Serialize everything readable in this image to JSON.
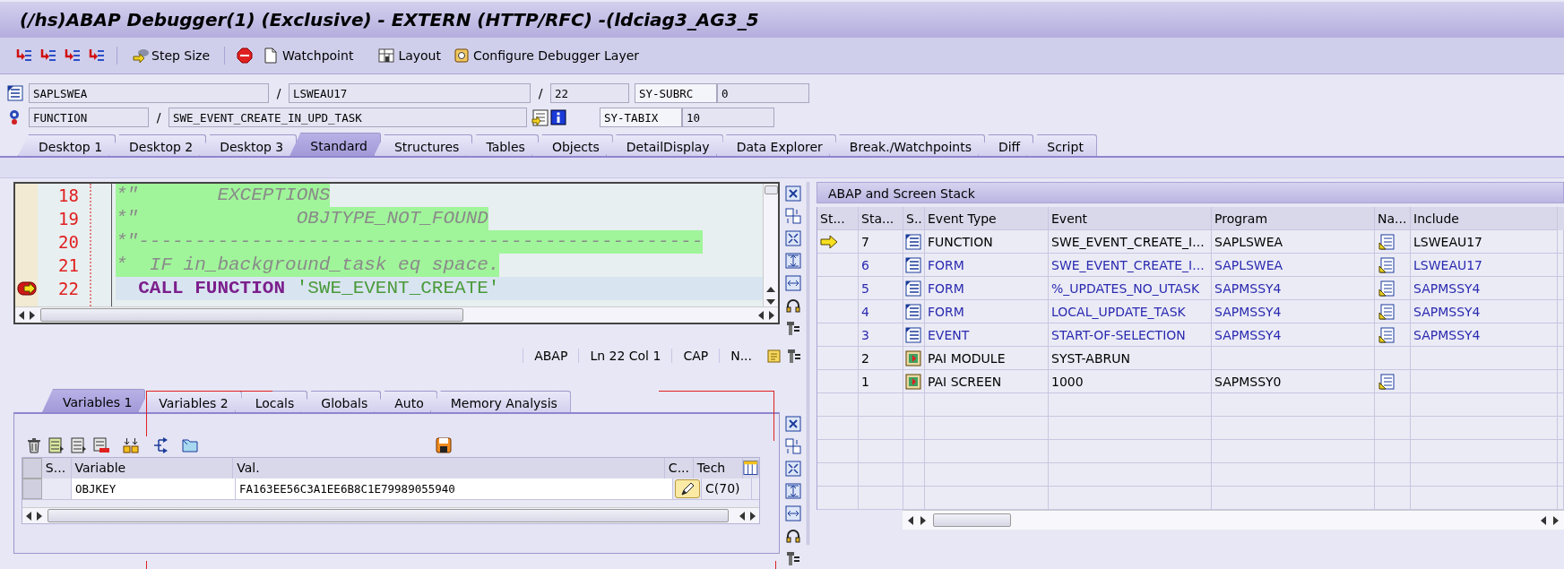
{
  "window": {
    "title": "(/hs)ABAP Debugger(1)  (Exclusive) - EXTERN (HTTP/RFC) -(ldciag3_AG3_5"
  },
  "toolbar": [
    {
      "label": "Step Size"
    },
    {
      "label": "Watchpoint"
    },
    {
      "label": "Layout"
    },
    {
      "label": "Configure Debugger Layer"
    }
  ],
  "info_rows": [
    [
      {
        "kind": "field",
        "value": "SAPLSWEA"
      },
      {
        "kind": "sep",
        "text": "/"
      },
      {
        "kind": "field",
        "value": "LSWEAU17"
      },
      {
        "kind": "sep",
        "text": "/"
      },
      {
        "kind": "field",
        "value": "22"
      },
      {
        "kind": "label",
        "text": "SY-SUBRC"
      },
      {
        "kind": "field",
        "value": "0"
      }
    ],
    [
      {
        "kind": "field",
        "value": "FUNCTION"
      },
      {
        "kind": "sep",
        "text": "/"
      },
      {
        "kind": "field",
        "value": "SWE_EVENT_CREATE_IN_UPD_TASK"
      },
      {
        "kind": "icons"
      },
      {
        "kind": "label",
        "text": "SY-TABIX"
      },
      {
        "kind": "field",
        "value": "10"
      }
    ]
  ],
  "desktop_tabs": [
    {
      "label": "Desktop 1",
      "selected": false
    },
    {
      "label": "Desktop 2",
      "selected": false
    },
    {
      "label": "Desktop 3",
      "selected": false
    },
    {
      "label": "Standard",
      "selected": true
    },
    {
      "label": "Structures",
      "selected": false
    },
    {
      "label": "Tables",
      "selected": false
    },
    {
      "label": "Objects",
      "selected": false
    },
    {
      "label": "DetailDisplay",
      "selected": false
    },
    {
      "label": "Data Explorer",
      "selected": false
    },
    {
      "label": "Break./Watchpoints",
      "selected": false
    },
    {
      "label": "Diff",
      "selected": false
    },
    {
      "label": "Script",
      "selected": false
    }
  ],
  "source_code": {
    "lines": [
      {
        "number": "18",
        "highlighted": true,
        "current": false,
        "marker": false,
        "tokens": [
          {
            "kind": "comment",
            "text": "*\"       EXCEPTIONS"
          }
        ]
      },
      {
        "number": "19",
        "highlighted": true,
        "current": false,
        "marker": false,
        "tokens": [
          {
            "kind": "comment",
            "text": "*\"              OBJTYPE_NOT_FOUND"
          }
        ]
      },
      {
        "number": "20",
        "highlighted": true,
        "current": false,
        "marker": false,
        "tokens": [
          {
            "kind": "comment",
            "text": "*\"--------------------------------------------------"
          }
        ]
      },
      {
        "number": "21",
        "highlighted": true,
        "current": false,
        "marker": false,
        "tokens": [
          {
            "kind": "comment",
            "text": "*  IF in_background_task eq space."
          }
        ]
      },
      {
        "number": "22",
        "highlighted": false,
        "current": true,
        "marker": true,
        "tokens": [
          {
            "kind": "keyword",
            "text": "  CALL FUNCTION"
          },
          {
            "kind": "string",
            "text": "'SWE_EVENT_CREATE'"
          }
        ]
      }
    ],
    "status": [
      "ABAP",
      "Ln  22 Col   1",
      "CAP",
      "N..."
    ]
  },
  "variable_tabs": [
    {
      "label": "Variables 1",
      "selected": true
    },
    {
      "label": "Variables 2",
      "selected": false
    },
    {
      "label": "Locals",
      "selected": false
    },
    {
      "label": "Globals",
      "selected": false
    },
    {
      "label": "Auto",
      "selected": false
    },
    {
      "label": "Memory Analysis",
      "selected": false
    }
  ],
  "variables": {
    "columns": [
      "S...",
      "Variable",
      "Val.",
      "C...",
      "Tech"
    ],
    "rows": [
      {
        "variable": "OBJKEY",
        "value": "FA163EE56C3A1EE6B8C1E79989055940",
        "type": "C(70)"
      }
    ]
  },
  "stack": {
    "title": "ABAP and Screen Stack",
    "columns": [
      "St...",
      "Sta...",
      "S..",
      "Event Type",
      "Event",
      "Program",
      "Na...",
      "Include"
    ],
    "rows": [
      {
        "current": true,
        "no": "7",
        "kind": "source",
        "event_type": "FUNCTION",
        "event": "SWE_EVENT_CREATE_I...",
        "program": "SAPLSWEA",
        "navigable": true,
        "include": "LSWEAU17",
        "color": "#000000"
      },
      {
        "current": false,
        "no": "6",
        "kind": "source",
        "event_type": "FORM",
        "event": "SWE_EVENT_CREATE_I...",
        "program": "SAPLSWEA",
        "navigable": true,
        "include": "LSWEAU17",
        "color": "#2a2ab0"
      },
      {
        "current": false,
        "no": "5",
        "kind": "source",
        "event_type": "FORM",
        "event": "%_UPDATES_NO_UTASK",
        "program": "SAPMSSY4",
        "navigable": true,
        "include": "SAPMSSY4",
        "color": "#2a2ab0"
      },
      {
        "current": false,
        "no": "4",
        "kind": "source",
        "event_type": "FORM",
        "event": "LOCAL_UPDATE_TASK",
        "program": "SAPMSSY4",
        "navigable": true,
        "include": "SAPMSSY4",
        "color": "#2a2ab0"
      },
      {
        "current": false,
        "no": "3",
        "kind": "source",
        "event_type": "EVENT",
        "event": "START-OF-SELECTION",
        "program": "SAPMSSY4",
        "navigable": true,
        "include": "SAPMSSY4",
        "color": "#2a2ab0"
      },
      {
        "current": false,
        "no": "2",
        "kind": "screen",
        "event_type": "PAI MODULE",
        "event": "SYST-ABRUN",
        "navigable": false,
        "color": "#000000"
      },
      {
        "current": false,
        "no": "1",
        "kind": "screen",
        "event_type": "PAI SCREEN",
        "event": "1000",
        "program": "SAPMSSY0",
        "navigable": true,
        "color": "#000000"
      }
    ]
  }
}
